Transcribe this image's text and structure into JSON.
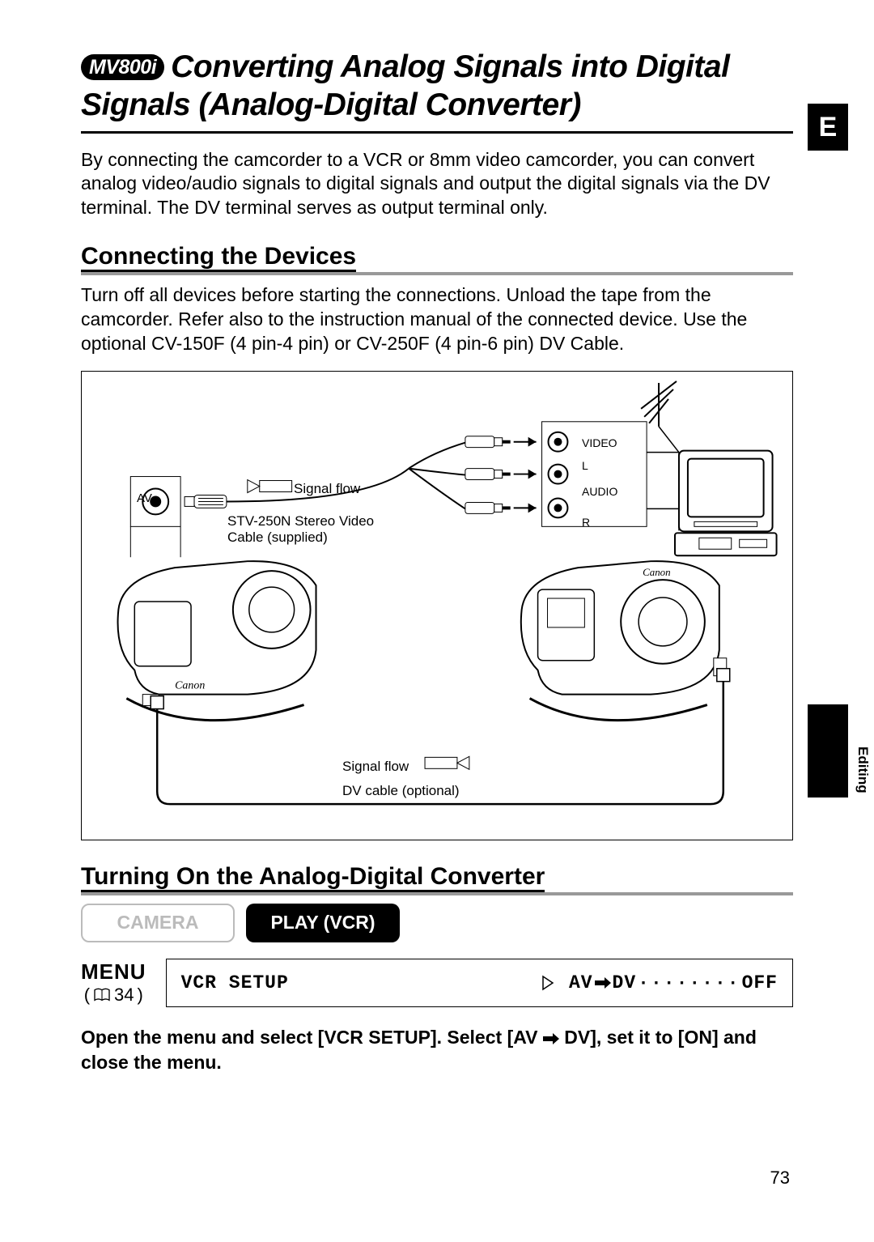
{
  "badge": "MV800i",
  "title_line1": "Converting Analog Signals into Digital",
  "title_line2": "Signals (Analog-Digital Converter)",
  "intro": "By connecting the camcorder to a VCR or 8mm video camcorder, you can convert analog video/audio signals to digital signals and output the digital signals via the DV terminal. The DV terminal serves as output terminal only.",
  "section1": "Connecting the Devices",
  "connect_text": "Turn off all devices before starting the connections. Unload the tape from the camcorder. Refer also to the instruction manual of the connected device. Use the optional CV-150F (4 pin-4 pin) or CV-250F (4 pin-6 pin) DV Cable.",
  "diagram": {
    "av": "AV",
    "signal_flow": "Signal flow",
    "stv": "STV-250N Stereo Video Cable (supplied)",
    "video": "VIDEO",
    "audio": "AUDIO",
    "l": "L",
    "r": "R",
    "signal_flow2": "Signal flow",
    "dv_cable": "DV cable (optional)"
  },
  "section2": "Turning On the Analog-Digital Converter",
  "modes": {
    "camera": "CAMERA",
    "play": "PLAY (VCR)"
  },
  "menu": {
    "label": "MENU",
    "page_ref": "34",
    "vcr_setup": "VCR SETUP",
    "avdv": "AV",
    "dv": "DV",
    "dots": "········",
    "off": "OFF"
  },
  "instruction_a": "Open the menu and select [VCR SETUP]. Select [AV",
  "instruction_b": "DV], set it to [ON] and close the menu.",
  "side_e": "E",
  "side_editing": "Editing",
  "page_number": "73"
}
